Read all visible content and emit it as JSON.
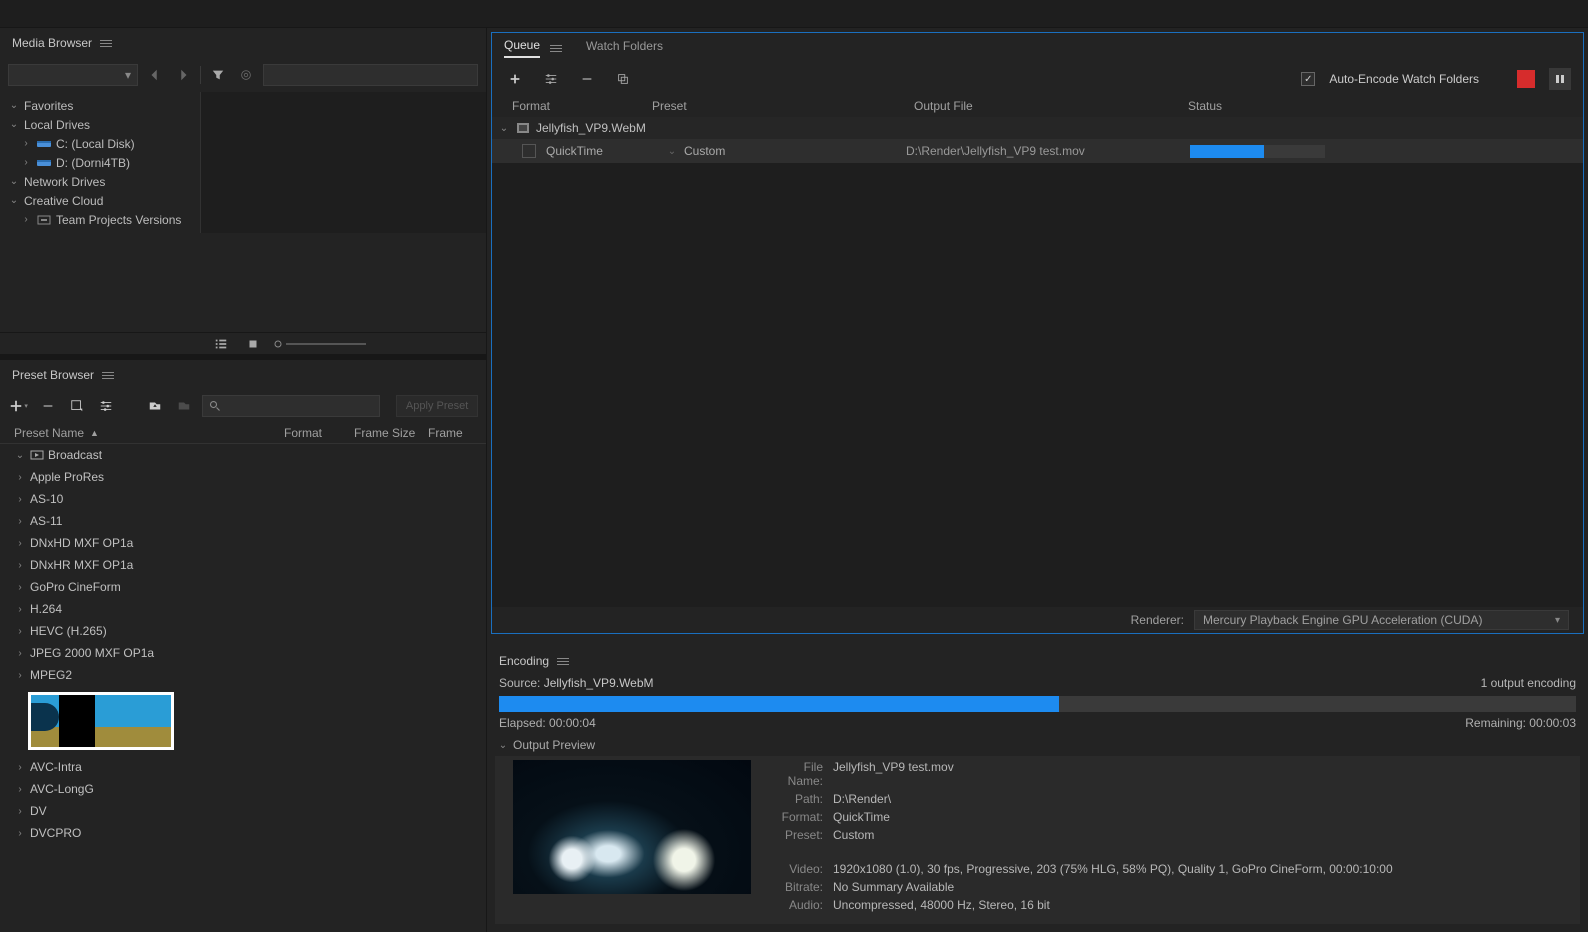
{
  "mediaBrowser": {
    "title": "Media Browser",
    "tree": {
      "favorites": "Favorites",
      "localDrives": "Local Drives",
      "driveC": "C: (Local Disk)",
      "driveD": "D: (Dorni4TB)",
      "networkDrives": "Network Drives",
      "creativeCloud": "Creative Cloud",
      "teamProjects": "Team Projects Versions"
    }
  },
  "presetBrowser": {
    "title": "Preset Browser",
    "applyBtn": "Apply Preset",
    "headers": {
      "name": "Preset Name",
      "format": "Format",
      "frameSize": "Frame Size",
      "frame": "Frame"
    },
    "groups": {
      "broadcast": "Broadcast",
      "items": [
        "Apple ProRes",
        "AS-10",
        "AS-11",
        "DNxHD MXF OP1a",
        "DNxHR MXF OP1a",
        "GoPro CineForm",
        "H.264",
        "HEVC (H.265)",
        "JPEG 2000 MXF OP1a",
        "MPEG2",
        "AVC-Intra",
        "AVC-LongG",
        "DV",
        "DVCPRO"
      ]
    }
  },
  "queue": {
    "tabs": {
      "queue": "Queue",
      "watch": "Watch Folders"
    },
    "autoEncode": "Auto-Encode Watch Folders",
    "headers": {
      "format": "Format",
      "preset": "Preset",
      "output": "Output File",
      "status": "Status"
    },
    "source": "Jellyfish_VP9.WebM",
    "row": {
      "format": "QuickTime",
      "preset": "Custom",
      "output": "D:\\Render\\Jellyfish_VP9 test.mov"
    },
    "progressPct": 55,
    "rendererLabel": "Renderer:",
    "renderer": "Mercury Playback Engine GPU Acceleration (CUDA)"
  },
  "encoding": {
    "title": "Encoding",
    "sourceLabel": "Source:",
    "source": "Jellyfish_VP9.WebM",
    "outputCount": "1 output encoding",
    "progressPct": 52,
    "elapsed": "Elapsed: 00:00:04",
    "remaining": "Remaining: 00:00:03",
    "outputPreview": "Output Preview",
    "details": {
      "fileNameLabel": "File Name:",
      "fileName": "Jellyfish_VP9 test.mov",
      "pathLabel": "Path:",
      "path": "D:\\Render\\",
      "formatLabel": "Format:",
      "format": "QuickTime",
      "presetLabel": "Preset:",
      "preset": "Custom",
      "videoLabel": "Video:",
      "video": "1920x1080 (1.0), 30 fps, Progressive, 203 (75% HLG, 58% PQ), Quality 1, GoPro CineForm, 00:00:10:00",
      "bitrateLabel": "Bitrate:",
      "bitrate": "No Summary Available",
      "audioLabel": "Audio:",
      "audio": "Uncompressed, 48000 Hz, Stereo, 16 bit"
    }
  }
}
